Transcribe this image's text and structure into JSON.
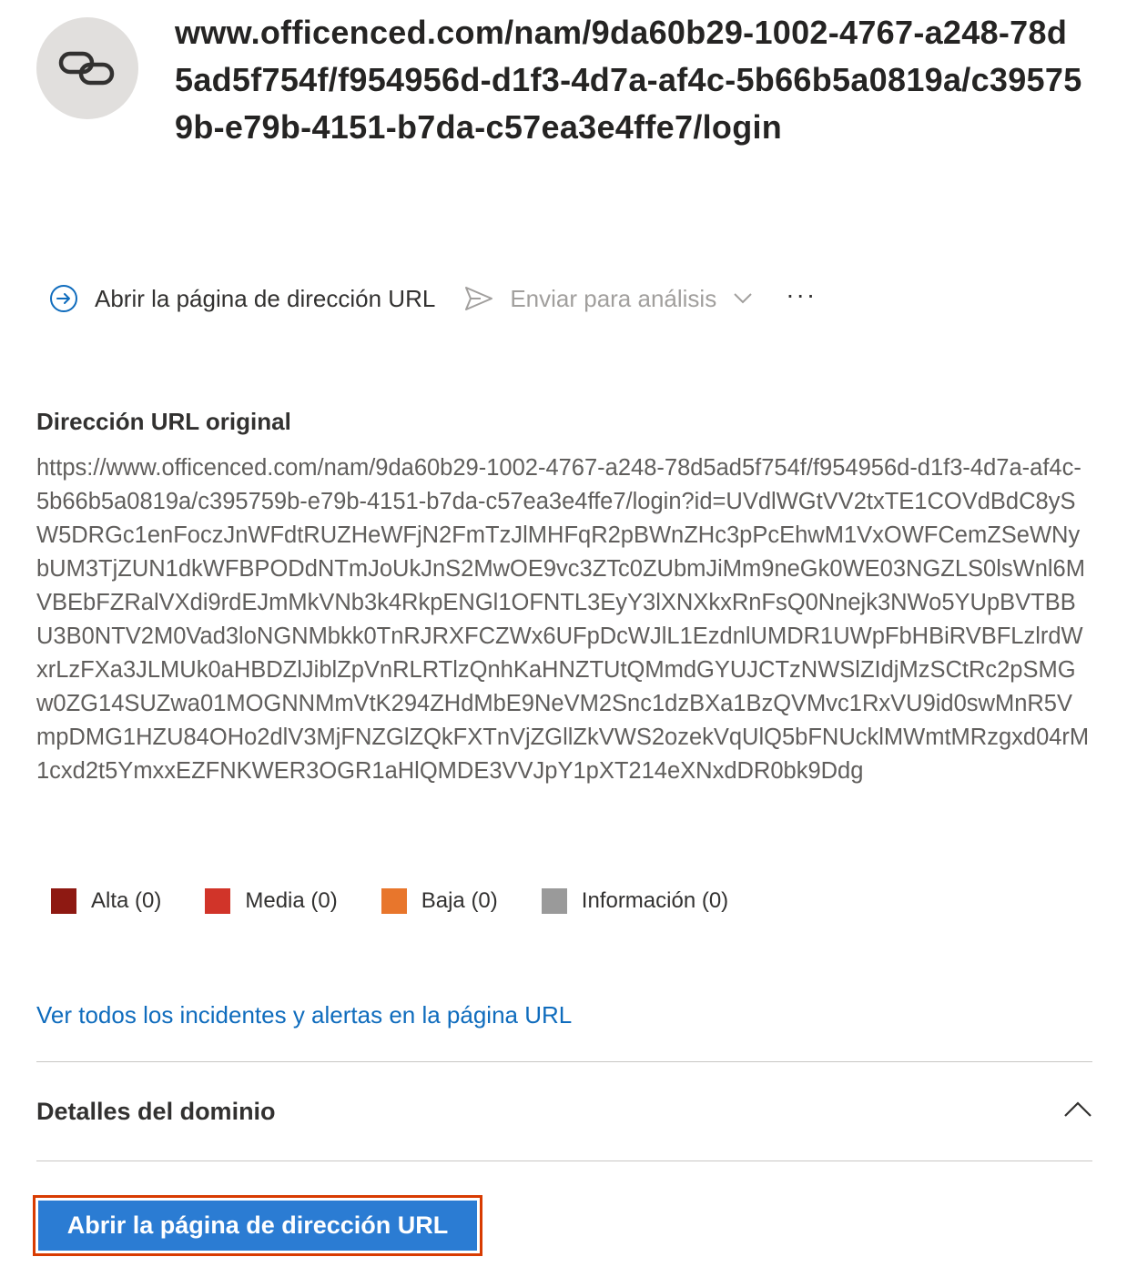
{
  "header": {
    "title": "www.officenced.com/nam/9da60b29-1002-4767-a248-78d5ad5f754f/f954956d-d1f3-4d7a-af4c-5b66b5a0819a/c395759b-e79b-4151-b7da-c57ea3e4ffe7/login",
    "icon": "link-icon"
  },
  "toolbar": {
    "open_label": "Abrir la página de dirección URL",
    "submit_label": "Enviar para análisis",
    "more_label": "···"
  },
  "original_url": {
    "label": "Dirección URL original",
    "value": "https://www.officenced.com/nam/9da60b29-1002-4767-a248-78d5ad5f754f/f954956d-d1f3-4d7a-af4c-5b66b5a0819a/c395759b-e79b-4151-b7da-c57ea3e4ffe7/login?id=UVdlWGtVV2txTE1COVdBdC8ySW5DRGc1enFoczJnWFdtRUZHeWFjN2FmTzJlMHFqR2pBWnZHc3pPcEhwM1VxOWFCemZSeWNybUM3TjZUN1dkWFBPODdNTmJoUkJnS2MwOE9vc3ZTc0ZUbmJiMm9neGk0WE03NGZLS0lsWnl6MVBEbFZRalVXdi9rdEJmMkVNb3k4RkpENGl1OFNTL3EyY3lXNXkxRnFsQ0Nnejk3NWo5YUpBVTBBU3B0NTV2M0Vad3loNGNMbkk0TnRJRXFCZWx6UFpDcWJlL1EzdnlUMDR1UWpFbHBiRVBFLzlrdWxrLzFXa3JLMUk0aHBDZlJiblZpVnRLRTlzQnhKaHNZTUtQMmdGYUJCTzNWSlZIdjMzSCtRc2pSMGw0ZG14SUZwa01MOGNNMmVtK294ZHdMbE9NeVM2Snc1dzBXa1BzQVMvc1RxVU9id0swMnR5VmpDMG1HZU84OHo2dlV3MjFNZGlZQkFXTnVjZGllZkVWS2ozekVqUlQ5bFNUcklMWmtMRzgxd04rM1cxd2t5YmxxEZFNKWER3OGR1aHlQMDE3VVJpY1pXT214eXNxdDR0bk9Ddg"
  },
  "severity_legend": [
    {
      "label": "Alta (0)",
      "color": "#8e1912"
    },
    {
      "label": "Media (0)",
      "color": "#d13429"
    },
    {
      "label": "Baja (0)",
      "color": "#e8762c"
    },
    {
      "label": "Información (0)",
      "color": "#9a9a9a"
    }
  ],
  "links": {
    "view_all": "Ver todos los incidentes y alertas en la página URL"
  },
  "domain_section": {
    "title": "Detalles del dominio",
    "expanded": true
  },
  "primary_button": {
    "label": "Abrir la página de dirección URL"
  },
  "colors": {
    "accent": "#2b7cd3",
    "link": "#0f6cbd",
    "highlight_border": "#d83b01"
  }
}
